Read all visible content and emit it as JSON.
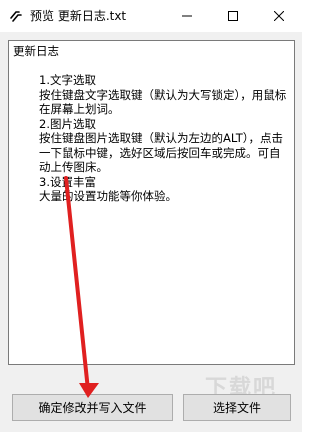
{
  "window": {
    "title": "预览 更新日志.txt",
    "icon": "link-chain-icon"
  },
  "content": {
    "heading": "更新日志",
    "items": [
      {
        "title": "1.文字选取",
        "desc": "按住键盘文字选取键（默认为大写锁定），用鼠标在屏幕上划词。"
      },
      {
        "title": "2.图片选取",
        "desc": "按住键盘图片选取键（默认为左边的ALT），点击一下鼠标中键，选好区域后按回车或完成。可自动上传图床。"
      },
      {
        "title": "3.设置丰富",
        "desc": "大量的设置功能等你体验。"
      }
    ]
  },
  "buttons": {
    "confirm": "确定修改并写入文件",
    "select": "选择文件"
  },
  "annotation": {
    "color": "#e02020"
  },
  "watermark": "下载吧"
}
